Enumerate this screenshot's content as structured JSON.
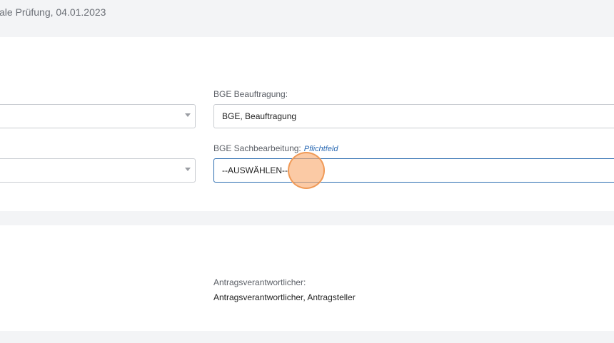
{
  "header": {
    "title": "ale Prüfung, 04.01.2023"
  },
  "assignment_section": {
    "left_select_1": {
      "value": ""
    },
    "left_select_2": {
      "value": ""
    },
    "bge_beauftragung": {
      "label": "BGE Beauftragung:",
      "value": "BGE, Beauftragung"
    },
    "bge_sachbearbeitung": {
      "label": "BGE Sachbearbeitung:",
      "required_hint": "Pflichtfeld",
      "value": "--AUSWÄHLEN--"
    }
  },
  "responsible_section": {
    "antragsverantwortlicher": {
      "label": "Antragsverantwortlicher:",
      "value": "Antragsverantwortlicher, Antragsteller"
    }
  },
  "icons": {
    "dropdown": "caret-down-icon",
    "click_marker": "click-indicator"
  },
  "colors": {
    "page_background": "#f3f4f6",
    "panel_background": "#ffffff",
    "active_border": "#2b6cb0",
    "required_hint": "#2f6db5",
    "click_marker": "#f8aa6e"
  }
}
